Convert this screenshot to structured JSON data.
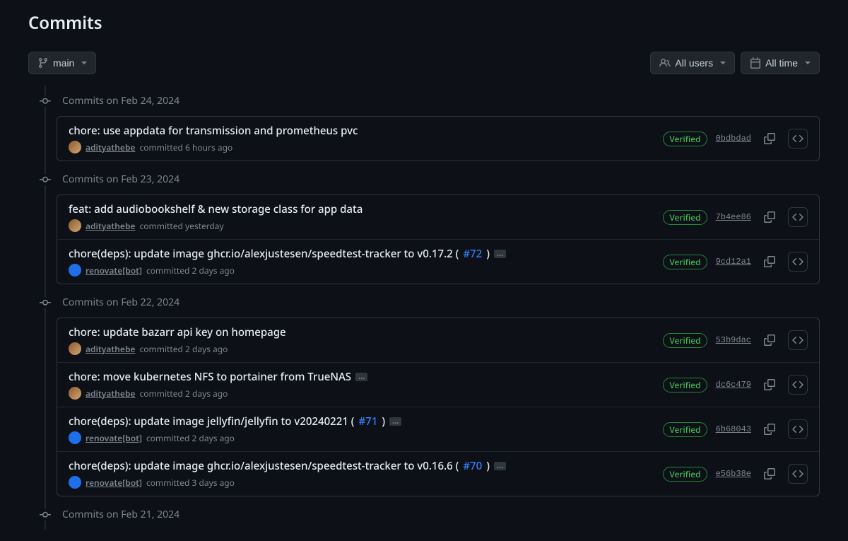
{
  "page": {
    "title": "Commits"
  },
  "toolbar": {
    "branch": "main",
    "users": "All users",
    "time": "All time"
  },
  "groups": [
    {
      "date": "Commits on Feb 24, 2024",
      "commits": [
        {
          "title": "chore: use appdata for transmission and prometheus pvc",
          "author": "adityathebe",
          "avatar": "u1",
          "when": "6 hours ago",
          "verified": "Verified",
          "sha": "0bdbdad",
          "pr": null,
          "ellipsis": false
        }
      ]
    },
    {
      "date": "Commits on Feb 23, 2024",
      "commits": [
        {
          "title": "feat: add audiobookshelf & new storage class for app data",
          "author": "adityathebe",
          "avatar": "u1",
          "when": "yesterday",
          "verified": "Verified",
          "sha": "7b4ee86",
          "pr": null,
          "ellipsis": false
        },
        {
          "title": "chore(deps): update image ghcr.io/alexjustesen/speedtest-tracker to v0.17.2 (",
          "author": "renovate[bot]",
          "avatar": "bot",
          "when": "2 days ago",
          "verified": "Verified",
          "sha": "9cd12a1",
          "pr": "#72",
          "ellipsis": true
        }
      ]
    },
    {
      "date": "Commits on Feb 22, 2024",
      "commits": [
        {
          "title": "chore: update bazarr api key on homepage",
          "author": "adityathebe",
          "avatar": "u1",
          "when": "2 days ago",
          "verified": "Verified",
          "sha": "53b9dac",
          "pr": null,
          "ellipsis": false
        },
        {
          "title": "chore: move kubernetes NFS to portainer from TrueNAS",
          "author": "adityathebe",
          "avatar": "u1",
          "when": "2 days ago",
          "verified": "Verified",
          "sha": "dc6c479",
          "pr": null,
          "ellipsis": true
        },
        {
          "title": "chore(deps): update image jellyfin/jellyfin to v20240221 (",
          "author": "renovate[bot]",
          "avatar": "bot",
          "when": "2 days ago",
          "verified": "Verified",
          "sha": "6b68043",
          "pr": "#71",
          "ellipsis": true
        },
        {
          "title": "chore(deps): update image ghcr.io/alexjustesen/speedtest-tracker to v0.16.6 (",
          "author": "renovate[bot]",
          "avatar": "bot",
          "when": "3 days ago",
          "verified": "Verified",
          "sha": "e56b38e",
          "pr": "#70",
          "ellipsis": true
        }
      ]
    },
    {
      "date": "Commits on Feb 21, 2024",
      "commits": []
    }
  ],
  "labels": {
    "committed": "committed"
  }
}
